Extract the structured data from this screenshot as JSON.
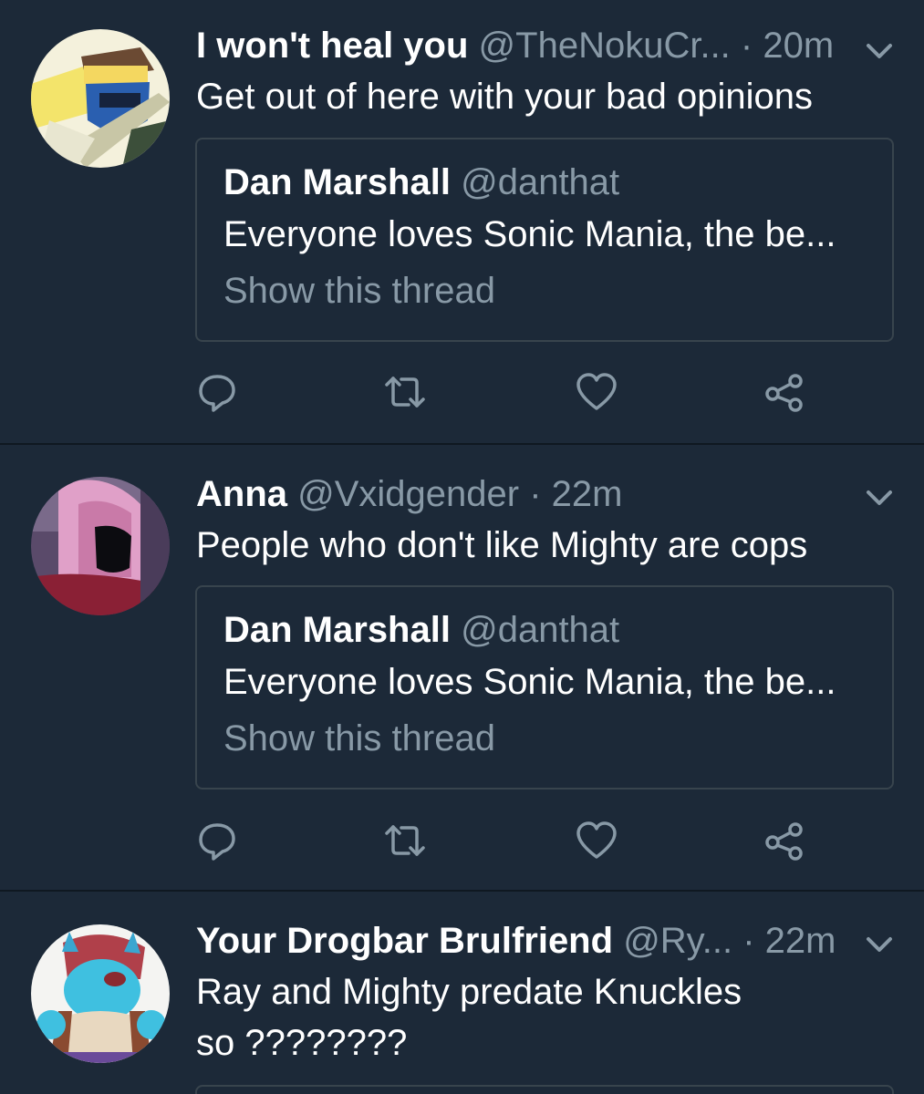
{
  "colors": {
    "background": "#1c2938",
    "divider": "#0f1821",
    "secondary_text": "#8899a6",
    "border": "#38444d"
  },
  "icons": {
    "reply": "reply-icon",
    "retweet": "retweet-icon",
    "like": "heart-icon",
    "share": "share-icon",
    "more": "chevron-down-icon"
  },
  "tweets": [
    {
      "name": "I won't heal you",
      "handle": "@TheNokuCr...",
      "time": "· 20m",
      "text": "Get out of here with your bad opinions",
      "quote": {
        "name": "Dan Marshall",
        "handle": "@danthat",
        "text": "Everyone loves Sonic Mania, the be...",
        "link": "Show this thread"
      }
    },
    {
      "name": "Anna",
      "handle": "@Vxidgender",
      "time": "· 22m",
      "text": "People who don't like Mighty are cops",
      "quote": {
        "name": "Dan Marshall",
        "handle": "@danthat",
        "text": "Everyone loves Sonic Mania, the be...",
        "link": "Show this thread"
      }
    },
    {
      "name": "Your Drogbar Brulfriend",
      "handle": "@Ry...",
      "time": "· 22m",
      "text_line1": "Ray and Mighty predate Knuckles",
      "text_line2": "so ????????"
    }
  ]
}
